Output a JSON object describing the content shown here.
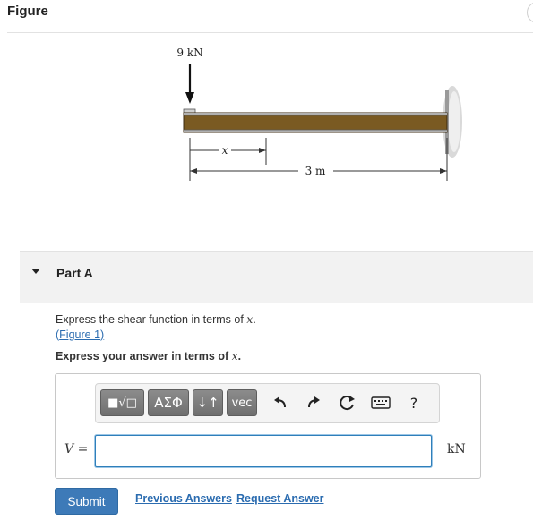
{
  "figure": {
    "title": "Figure",
    "load_label": "9 kN",
    "x_label": "x",
    "length_label": "3 m"
  },
  "part": {
    "label": "Part A"
  },
  "question": {
    "text_prefix": "Express the shear function in terms of ",
    "var": "x",
    "text_suffix": ".",
    "link_open": "(",
    "link_text": "Figure 1",
    "link_close": ")"
  },
  "instruction": {
    "prefix": "Express your answer in terms of ",
    "var": "x",
    "suffix": "."
  },
  "toolbar": {
    "templates_label": "■√□",
    "symbols_label": "ΑΣΦ",
    "sub_sup_label": "↓↑",
    "vec_label": "vec",
    "undo_icon": "undo-icon",
    "redo_icon": "redo-icon",
    "reset_icon": "reset-icon",
    "keyboard_icon": "keyboard-icon",
    "help_label": "?"
  },
  "answer": {
    "variable": "V",
    "equals": " =",
    "value": "",
    "unit": "kN"
  },
  "actions": {
    "submit_label": "Submit",
    "previous_answers_label": "Previous Answers",
    "request_answer_label": "Request Answer"
  }
}
